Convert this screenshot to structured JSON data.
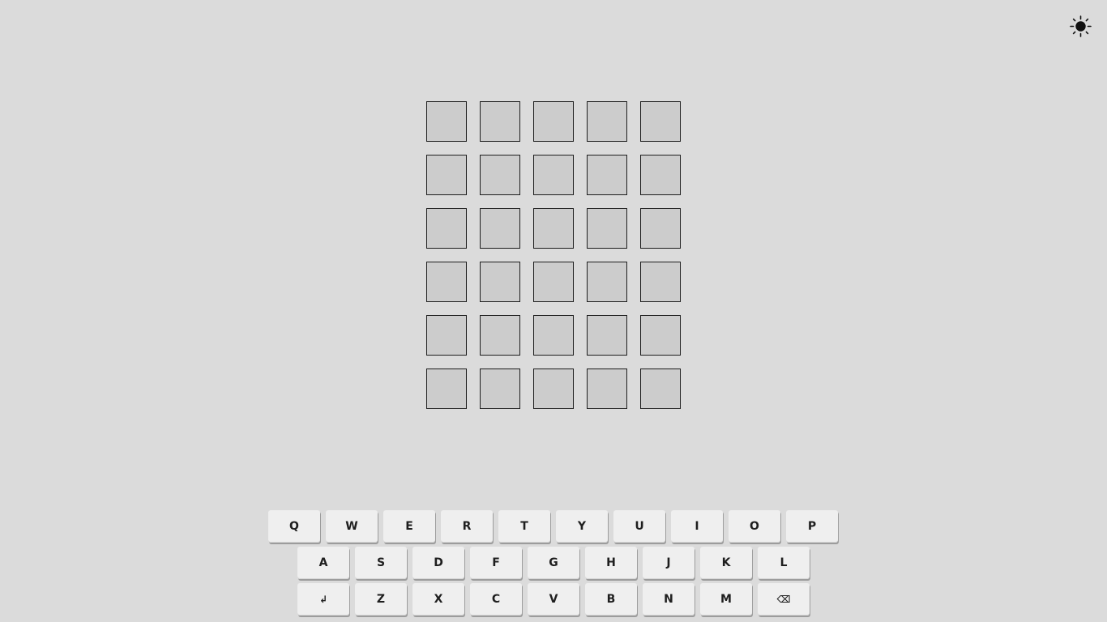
{
  "theme_toggle": {
    "icon": "sun-icon"
  },
  "board": {
    "rows": [
      [
        "",
        "",
        "",
        "",
        ""
      ],
      [
        "",
        "",
        "",
        "",
        ""
      ],
      [
        "",
        "",
        "",
        "",
        ""
      ],
      [
        "",
        "",
        "",
        "",
        ""
      ],
      [
        "",
        "",
        "",
        "",
        ""
      ],
      [
        "",
        "",
        "",
        "",
        ""
      ]
    ]
  },
  "keyboard": {
    "row1": [
      "Q",
      "W",
      "E",
      "R",
      "T",
      "Y",
      "U",
      "I",
      "O",
      "P"
    ],
    "row2": [
      "A",
      "S",
      "D",
      "F",
      "G",
      "H",
      "J",
      "K",
      "L"
    ],
    "row3": [
      "↲",
      "Z",
      "X",
      "C",
      "V",
      "B",
      "N",
      "M",
      "⌫"
    ]
  },
  "colors": {
    "background": "#dbdbdb",
    "tile_fill": "#cccccc",
    "tile_border": "#1e1e1e",
    "key_fill": "#efefef",
    "text": "#1e1e1e"
  }
}
